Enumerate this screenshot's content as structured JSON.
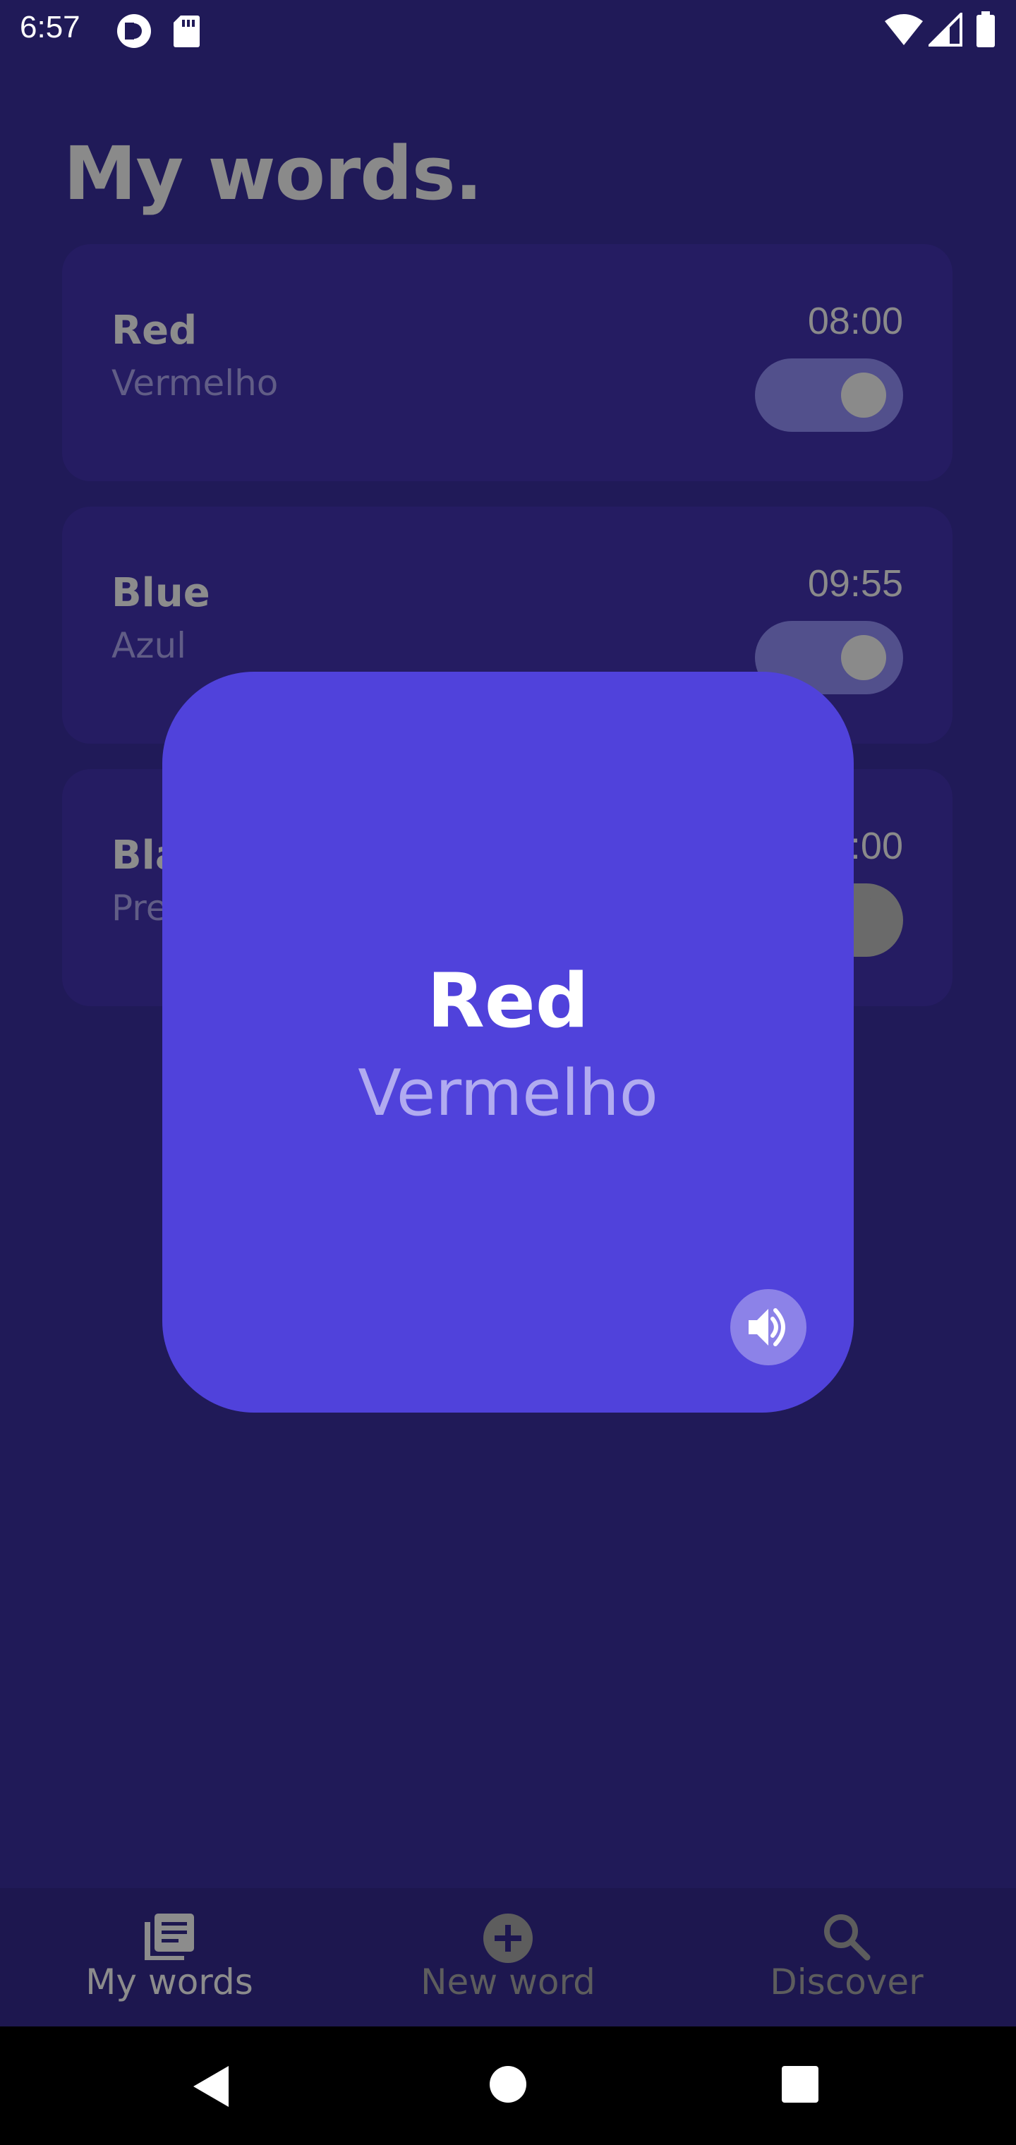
{
  "status_bar": {
    "time": "6:57",
    "icons": [
      "pocket-casts-icon",
      "sd-card-icon",
      "wifi-icon",
      "signal-icon",
      "battery-icon"
    ]
  },
  "page": {
    "title": "My words."
  },
  "words": [
    {
      "word": "Red",
      "translation": "Vermelho",
      "time": "08:00",
      "enabled": true
    },
    {
      "word": "Blue",
      "translation": "Azul",
      "time": "09:55",
      "enabled": true
    },
    {
      "word": "Black",
      "translation": "Preto",
      "time": "10:00",
      "enabled": false
    }
  ],
  "dialog": {
    "word": "Red",
    "translation": "Vermelho",
    "speaker_icon": "speaker-icon"
  },
  "bottom_nav": {
    "items": [
      {
        "label": "My words",
        "icon": "library-icon",
        "active": true
      },
      {
        "label": "New word",
        "icon": "add-circle-icon",
        "active": false
      },
      {
        "label": "Discover",
        "icon": "search-icon",
        "active": false
      }
    ]
  },
  "colors": {
    "background": "#201a58",
    "dialog": "#5042db",
    "accent_light": "#b1abf0"
  }
}
